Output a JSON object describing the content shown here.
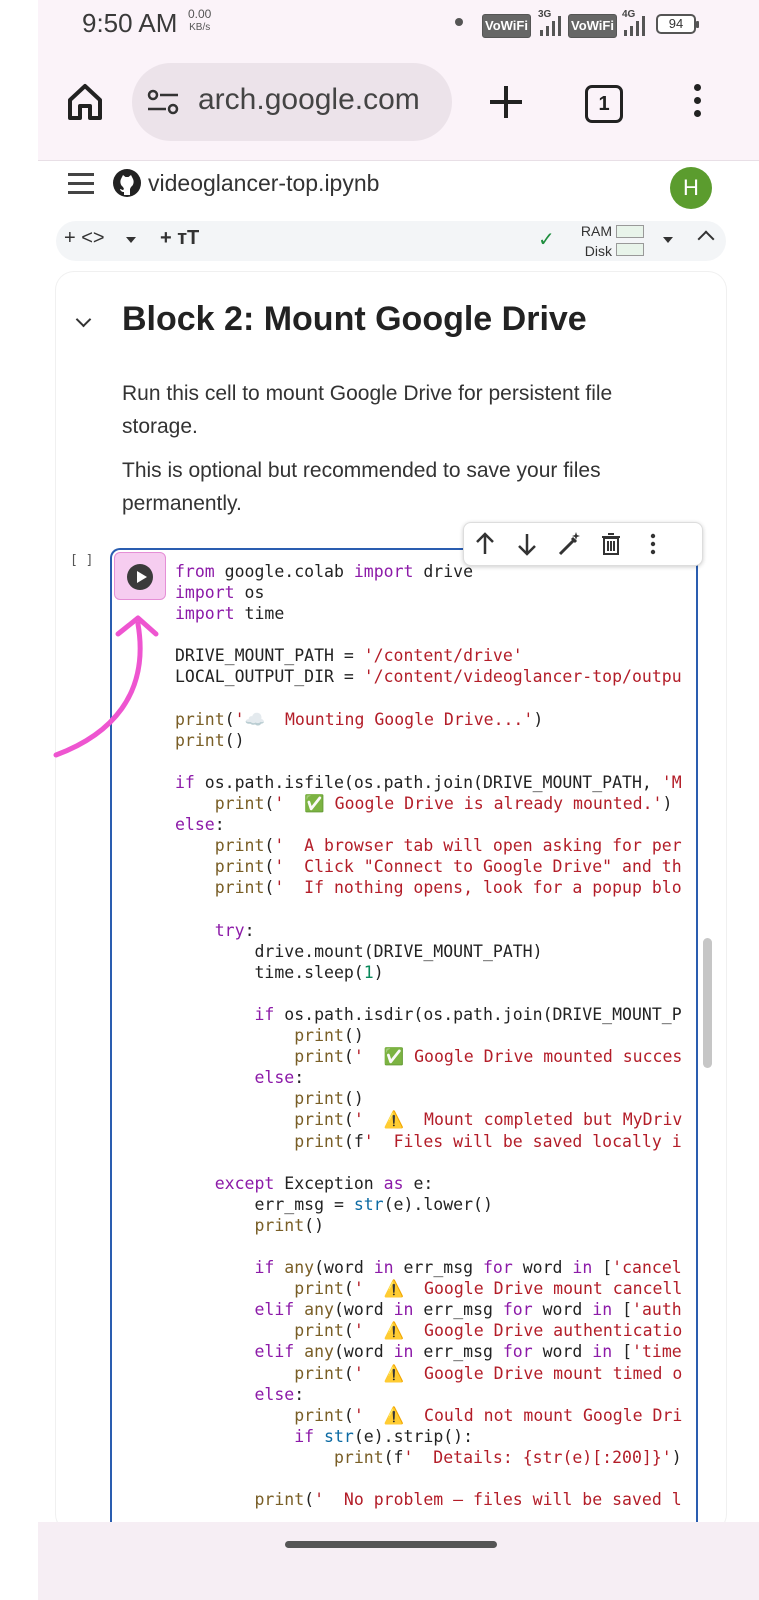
{
  "status_bar": {
    "time": "9:50 AM",
    "net_speed": "0.00",
    "net_unit": "KB/s",
    "vowifi_1": "VoWiFi",
    "net_3g": "3G",
    "vowifi_2": "VoWiFi",
    "net_4g": "4G",
    "battery": "94"
  },
  "browser": {
    "url": "arch.google.com",
    "tab_count": "1",
    "icons": [
      "home-icon",
      "site-settings-icon",
      "plus-icon",
      "more-vert-icon"
    ]
  },
  "colab": {
    "notebook_title": "videoglancer-top.ipynb",
    "avatar_initial": "H",
    "toolbar": {
      "code_label": "+ <>",
      "text_label": "+ тT",
      "ram_label": "RAM",
      "disk_label": "Disk",
      "status_color": "#1e8e3e"
    }
  },
  "notebook": {
    "heading": "Block 2: Mount Google Drive",
    "paragraph_1": "Run this cell to mount Google Drive for persistent file storage.",
    "paragraph_2": "This is optional but recommended to save your files permanently.",
    "exec_count": "[ ]",
    "cell_tool_icons": [
      "arrow-up-icon",
      "arrow-down-icon",
      "ai-wand-icon",
      "delete-icon",
      "more-vert-icon"
    ],
    "code_lines": [
      "from google.colab import drive",
      "import os",
      "import time",
      "",
      "DRIVE_MOUNT_PATH = '/content/drive'",
      "LOCAL_OUTPUT_DIR = '/content/videoglancer-top/outpu",
      "",
      "print('☁️  Mounting Google Drive...')",
      "print()",
      "",
      "if os.path.isfile(os.path.join(DRIVE_MOUNT_PATH, 'M",
      "    print('  ✅ Google Drive is already mounted.')",
      "else:",
      "    print('  A browser tab will open asking for per",
      "    print('  Click \"Connect to Google Drive\" and th",
      "    print('  If nothing opens, look for a popup blo",
      "",
      "    try:",
      "        drive.mount(DRIVE_MOUNT_PATH)",
      "        time.sleep(1)",
      "",
      "        if os.path.isdir(os.path.join(DRIVE_MOUNT_P",
      "            print()",
      "            print('  ✅ Google Drive mounted succes",
      "        else:",
      "            print()",
      "            print('  ⚠️  Mount completed but MyDriv",
      "            print(f'  Files will be saved locally i",
      "",
      "    except Exception as e:",
      "        err_msg = str(e).lower()",
      "        print()",
      "",
      "        if any(word in err_msg for word in ['cancel",
      "            print('  ⚠️  Google Drive mount cancell",
      "        elif any(word in err_msg for word in ['auth",
      "            print('  ⚠️  Google Drive authenticatio",
      "        elif any(word in err_msg for word in ['time",
      "            print('  ⚠️  Google Drive mount timed o",
      "        else:",
      "            print('  ⚠️  Could not mount Google Dri",
      "            if str(e).strip():",
      "                print(f'  Details: {str(e)[:200]}')",
      "",
      "        print('  No problem — files will be saved l"
    ],
    "annotation_color": "#ee55d0"
  }
}
